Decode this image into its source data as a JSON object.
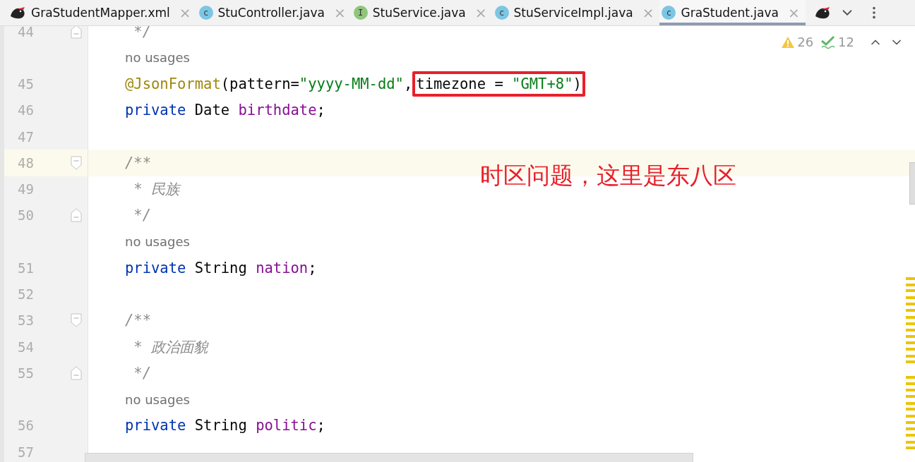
{
  "tabs": [
    {
      "label": "GraStudentMapper.xml",
      "icon": {
        "kind": "mybatis"
      },
      "close": "×",
      "selected": false
    },
    {
      "label": "StuController.java",
      "icon": {
        "kind": "class",
        "letter": "c"
      },
      "close": "×",
      "selected": false
    },
    {
      "label": "StuService.java",
      "icon": {
        "kind": "interface",
        "letter": "I"
      },
      "close": "×",
      "selected": false
    },
    {
      "label": "StuServiceImpl.java",
      "icon": {
        "kind": "class",
        "letter": "c"
      },
      "close": "×",
      "selected": false
    },
    {
      "label": "GraStudent.java",
      "icon": {
        "kind": "class",
        "letter": "c"
      },
      "close": "×",
      "selected": true
    }
  ],
  "inspection": {
    "warnings": "26",
    "checks": "12"
  },
  "lines": [
    {
      "kind": "code",
      "number": "44",
      "fold": {
        "kind": "end"
      },
      "current": false,
      "tokens": [
        {
          "text": " */",
          "kind": "comment"
        }
      ]
    },
    {
      "kind": "hint",
      "text": "no usages"
    },
    {
      "kind": "code",
      "number": "45",
      "current": false,
      "tokens": [
        {
          "text": "@JsonFormat",
          "kind": "annotation"
        },
        {
          "text": "(pattern=",
          "kind": "plain"
        },
        {
          "text": "\"yyyy-MM-dd\"",
          "kind": "string"
        },
        {
          "text": ",",
          "kind": "plain"
        },
        {
          "text": "timezone = ",
          "kind": "plain",
          "boxed": true
        },
        {
          "text": "\"GMT+8\"",
          "kind": "string",
          "boxed": true
        },
        {
          "text": ")",
          "kind": "plain",
          "boxed": true
        }
      ]
    },
    {
      "kind": "code",
      "number": "46",
      "current": false,
      "tokens": [
        {
          "text": "private ",
          "kind": "keyword"
        },
        {
          "text": "Date ",
          "kind": "plain"
        },
        {
          "text": "birthdate",
          "kind": "field"
        },
        {
          "text": ";",
          "kind": "plain"
        }
      ]
    },
    {
      "kind": "code",
      "number": "47",
      "current": false
    },
    {
      "kind": "code",
      "number": "48",
      "fold": {
        "kind": "start"
      },
      "current": true,
      "tokens": [
        {
          "text": "/**",
          "kind": "comment"
        }
      ]
    },
    {
      "kind": "code",
      "number": "49",
      "current": false,
      "tokens": [
        {
          "text": " * 民族",
          "kind": "comment"
        }
      ]
    },
    {
      "kind": "code",
      "number": "50",
      "fold": {
        "kind": "end"
      },
      "current": false,
      "tokens": [
        {
          "text": " */",
          "kind": "comment"
        }
      ]
    },
    {
      "kind": "hint",
      "text": "no usages"
    },
    {
      "kind": "code",
      "number": "51",
      "current": false,
      "tokens": [
        {
          "text": "private ",
          "kind": "keyword"
        },
        {
          "text": "String ",
          "kind": "plain"
        },
        {
          "text": "nation",
          "kind": "field"
        },
        {
          "text": ";",
          "kind": "plain"
        }
      ]
    },
    {
      "kind": "code",
      "number": "52",
      "current": false
    },
    {
      "kind": "code",
      "number": "53",
      "fold": {
        "kind": "start"
      },
      "current": false,
      "tokens": [
        {
          "text": "/**",
          "kind": "comment"
        }
      ]
    },
    {
      "kind": "code",
      "number": "54",
      "current": false,
      "tokens": [
        {
          "text": " * 政治面貌",
          "kind": "comment"
        }
      ]
    },
    {
      "kind": "code",
      "number": "55",
      "fold": {
        "kind": "end"
      },
      "current": false,
      "tokens": [
        {
          "text": " */",
          "kind": "comment"
        }
      ]
    },
    {
      "kind": "hint",
      "text": "no usages"
    },
    {
      "kind": "code",
      "number": "56",
      "current": false,
      "tokens": [
        {
          "text": "private ",
          "kind": "keyword"
        },
        {
          "text": "String ",
          "kind": "plain"
        },
        {
          "text": "politic",
          "kind": "field"
        },
        {
          "text": ";",
          "kind": "plain"
        }
      ]
    },
    {
      "kind": "code",
      "number": "57",
      "current": false
    }
  ],
  "annotation": "时区问题，这里是东八区"
}
